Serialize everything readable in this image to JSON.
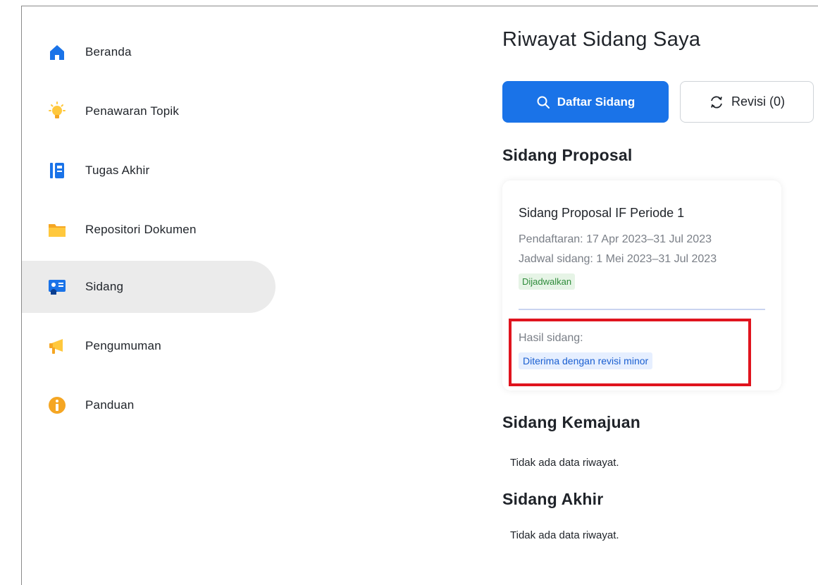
{
  "sidebar": {
    "items": [
      {
        "label": "Beranda",
        "icon": "home-icon",
        "active": false
      },
      {
        "label": "Penawaran Topik",
        "icon": "lightbulb-icon",
        "active": false
      },
      {
        "label": "Tugas Akhir",
        "icon": "notebook-icon",
        "active": false
      },
      {
        "label": "Repositori Dokumen",
        "icon": "folder-icon",
        "active": false
      },
      {
        "label": "Sidang",
        "icon": "presentation-icon",
        "active": true
      },
      {
        "label": "Pengumuman",
        "icon": "megaphone-icon",
        "active": false
      },
      {
        "label": "Panduan",
        "icon": "info-icon",
        "active": false
      }
    ]
  },
  "main": {
    "title": "Riwayat Sidang Saya",
    "buttons": {
      "primary_label": "Daftar Sidang",
      "secondary_label": "Revisi (0)"
    },
    "sections": {
      "proposal": {
        "title": "Sidang Proposal",
        "card": {
          "title": "Sidang Proposal IF Periode 1",
          "registration": "Pendaftaran: 17 Apr 2023–31 Jul 2023",
          "schedule": "Jadwal sidang: 1 Mei 2023–31 Jul 2023",
          "status_badge": "Dijadwalkan",
          "result_label": "Hasil sidang:",
          "result_badge": "Diterima dengan revisi minor"
        }
      },
      "kemajuan": {
        "title": "Sidang Kemajuan",
        "empty": "Tidak ada data riwayat."
      },
      "akhir": {
        "title": "Sidang Akhir",
        "empty": "Tidak ada data riwayat."
      }
    }
  },
  "colors": {
    "accent": "#1a73e8",
    "highlight": "#e0141e",
    "status_green": "#2e8b3a",
    "result_blue": "#1a5fd1"
  }
}
